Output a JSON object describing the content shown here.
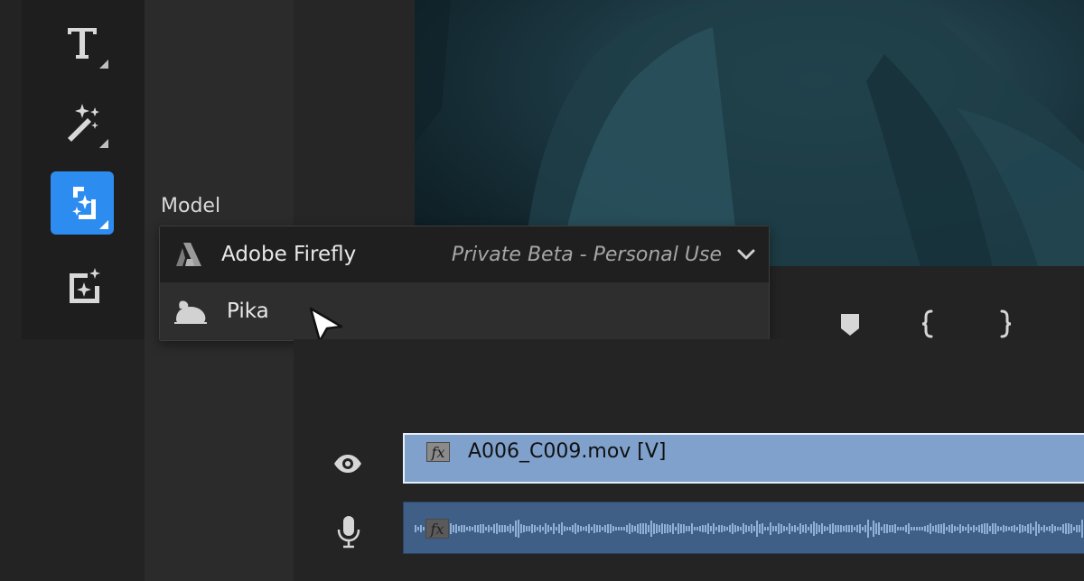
{
  "model_panel": {
    "label": "Model",
    "options": [
      {
        "label": "Adobe Firefly",
        "badge": "Private Beta - Personal Use",
        "icon": "adobe-firefly-icon",
        "selected": true
      },
      {
        "label": "Pika",
        "icon": "pika-rabbit-icon",
        "selected": false
      }
    ]
  },
  "tools": [
    {
      "icon": "type-tool-icon"
    },
    {
      "icon": "magic-wand-icon"
    },
    {
      "icon": "generative-extend-icon",
      "selected": true
    },
    {
      "icon": "generate-image-icon"
    }
  ],
  "timeline": {
    "video_clip": {
      "name": "A006_C009.mov [V]",
      "fx": "fx"
    },
    "audio_clip": {
      "fx": "fx"
    }
  },
  "colors": {
    "accent": "#2d8cf0",
    "video_clip": "#7fa1cc",
    "audio_clip": "#3f5f86"
  }
}
